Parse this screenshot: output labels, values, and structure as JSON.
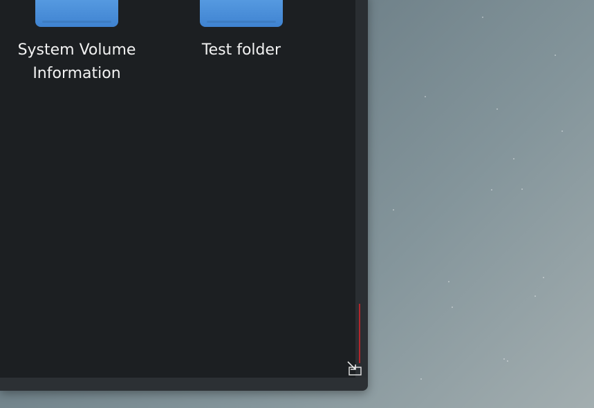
{
  "file_manager": {
    "items": [
      {
        "label": "System Volume Information",
        "icon": "folder-icon"
      },
      {
        "label": "Test folder",
        "icon": "folder-icon"
      }
    ],
    "resize_icon": "resize-handle-icon"
  },
  "colors": {
    "content_bg": "#1c1f22",
    "folder_blue": "#4a90de",
    "scroll_thumb": "#b3262c"
  }
}
